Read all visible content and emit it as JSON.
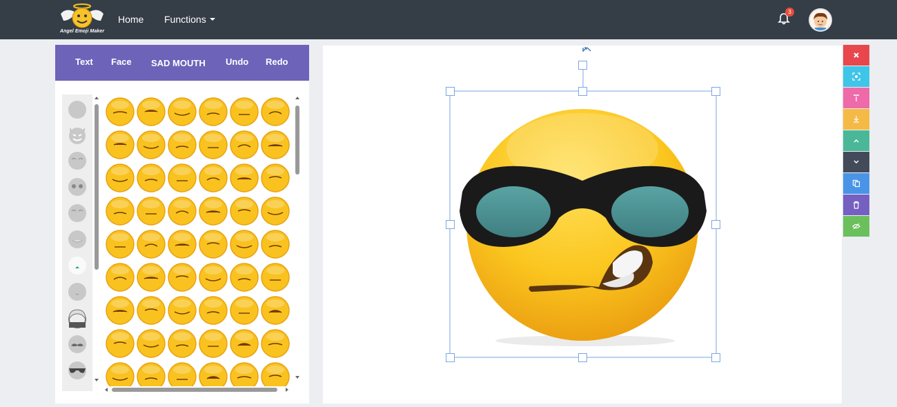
{
  "navbar": {
    "logo_text": "Angel Emoji Maker",
    "home_label": "Home",
    "functions_label": "Functions",
    "notification_count": "3",
    "bg_color": "#353d47"
  },
  "editor_tabs": {
    "text_label": "Text",
    "face_label": "Face",
    "active_category_label": "SAD MOUTH",
    "undo_label": "Undo",
    "redo_label": "Redo",
    "bg_color": "#6d63b9"
  },
  "categories": [
    {
      "icon": "plain-face-icon"
    },
    {
      "icon": "devil-face-icon"
    },
    {
      "icon": "closed-eyes-face-icon"
    },
    {
      "icon": "dot-eyes-face-icon"
    },
    {
      "icon": "brow-face-icon"
    },
    {
      "icon": "smile-face-icon"
    },
    {
      "icon": "green-mouth-face-icon"
    },
    {
      "icon": "small-mouth-face-icon"
    },
    {
      "icon": "hair-icon"
    },
    {
      "icon": "mustache-icon"
    },
    {
      "icon": "sunglasses-icon"
    }
  ],
  "mouth_grid_count": 54,
  "toolbar": [
    {
      "name": "close-icon",
      "color": "#e8474d"
    },
    {
      "name": "center-focus-icon",
      "color": "#3ec5e8"
    },
    {
      "name": "bring-to-front-icon",
      "color": "#ee6aa8"
    },
    {
      "name": "send-to-back-icon",
      "color": "#f5b945"
    },
    {
      "name": "move-up-icon",
      "color": "#4ab898"
    },
    {
      "name": "move-down-icon",
      "color": "#434b5a"
    },
    {
      "name": "duplicate-icon",
      "color": "#4a94e8"
    },
    {
      "name": "delete-icon",
      "color": "#7560c2"
    },
    {
      "name": "hide-layer-icon",
      "color": "#6cbf5d"
    }
  ]
}
